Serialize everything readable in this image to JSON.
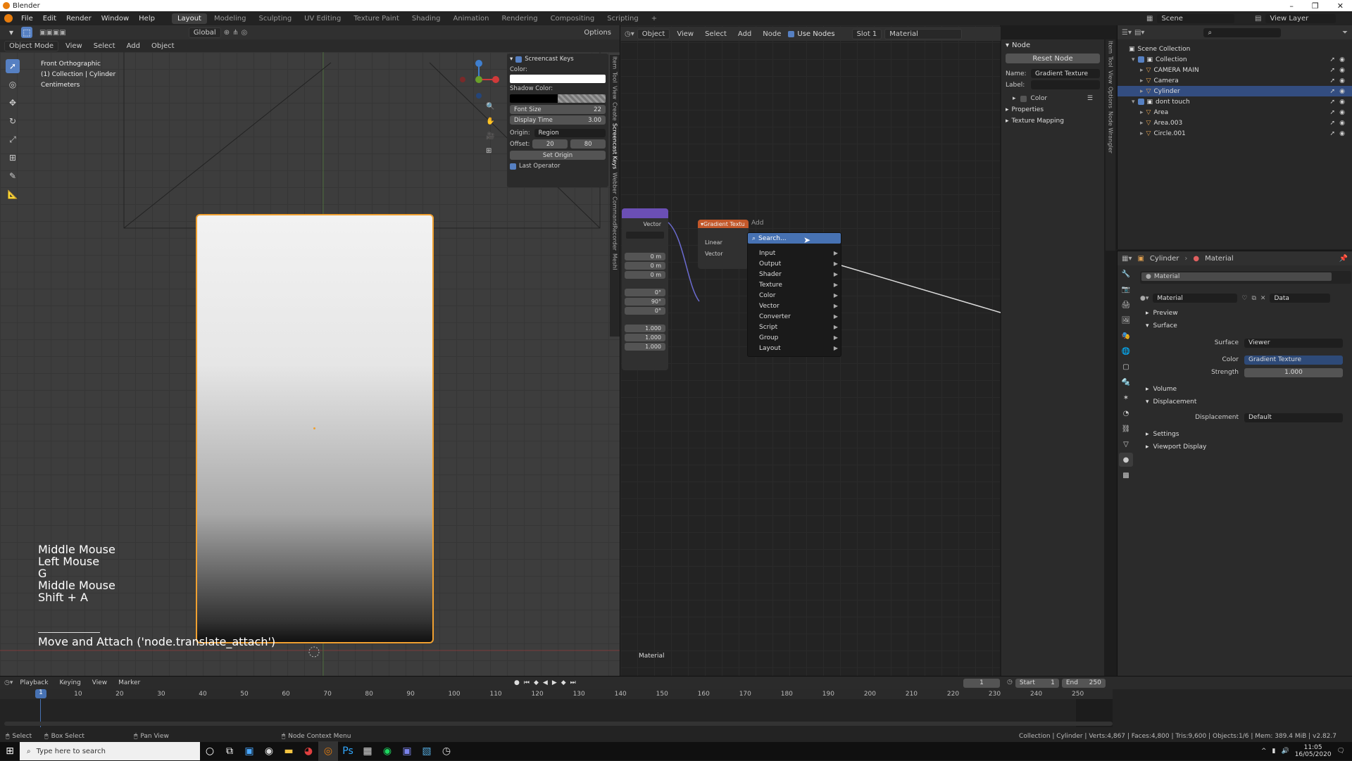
{
  "app": {
    "title": "Blender"
  },
  "menubar": {
    "items": [
      "File",
      "Edit",
      "Render",
      "Window",
      "Help"
    ],
    "workspaces": [
      "Layout",
      "Modeling",
      "Sculpting",
      "UV Editing",
      "Texture Paint",
      "Shading",
      "Animation",
      "Rendering",
      "Compositing",
      "Scripting"
    ],
    "active_workspace": "Layout",
    "scene_label": "Scene",
    "view_layer_label": "View Layer"
  },
  "viewport": {
    "mode": "Object Mode",
    "header_items": [
      "View",
      "Select",
      "Add",
      "Object"
    ],
    "orientation": "Global",
    "options": "Options",
    "info": {
      "line1": "Front Orthographic",
      "line2": "(1) Collection | Cylinder",
      "line3": "Centimeters"
    },
    "keys": [
      "Middle Mouse",
      "Left Mouse",
      "G",
      "Middle Mouse",
      "Shift + A"
    ],
    "operator_text": "Move and Attach ('node.translate_attach')",
    "side_tabs": [
      "Item",
      "Tool",
      "View",
      "Create",
      "Screencast Keys",
      "Webber",
      "CommandRecorder",
      "MeshI"
    ]
  },
  "screencast": {
    "title": "Screencast Keys",
    "color_label": "Color:",
    "shadow_label": "Shadow Color:",
    "font_size_label": "Font Size",
    "font_size": "22",
    "display_time_label": "Display Time",
    "display_time": "3.00",
    "origin_label": "Origin:",
    "origin_value": "Region",
    "offset_label": "Offset:",
    "offset_x": "20",
    "offset_y": "80",
    "set_origin": "Set Origin",
    "last_operator": "Last Operator"
  },
  "node_editor": {
    "header": {
      "object": "Object",
      "view": "View",
      "select": "Select",
      "add": "Add",
      "node": "Node",
      "use_nodes": "Use Nodes",
      "slot": "Slot 1",
      "material": "Material"
    },
    "mapping_node": {
      "vector": "Vector",
      "values": [
        "0 m",
        "0 m",
        "0 m",
        "0°",
        "90°",
        "0°",
        "1.000",
        "1.000",
        "1.000"
      ]
    },
    "gradient_node": {
      "title": "Gradient Textu",
      "type": "Linear",
      "vector": "Vector"
    },
    "add_menu": {
      "title": "Add",
      "search": "Search...",
      "items": [
        "Input",
        "Output",
        "Shader",
        "Texture",
        "Color",
        "Vector",
        "Converter",
        "Script",
        "Group",
        "Layout"
      ]
    },
    "footer_label": "Material",
    "side_tabs": [
      "Item",
      "Tool",
      "View",
      "Options",
      "Node Wrangler"
    ]
  },
  "node_panel": {
    "title": "Node",
    "reset": "Reset Node",
    "name_label": "Name:",
    "name_value": "Gradient Texture",
    "label_label": "Label:",
    "color": "Color",
    "properties": "Properties",
    "texture_mapping": "Texture Mapping"
  },
  "outliner": {
    "scene_collection": "Scene Collection",
    "rows": [
      {
        "label": "Collection",
        "indent": 1
      },
      {
        "label": "CAMERA MAIN",
        "indent": 2
      },
      {
        "label": "Camera",
        "indent": 2
      },
      {
        "label": "Cylinder",
        "indent": 2,
        "selected": true
      },
      {
        "label": "dont touch",
        "indent": 1
      },
      {
        "label": "Area",
        "indent": 2
      },
      {
        "label": "Area.003",
        "indent": 2
      },
      {
        "label": "Circle.001",
        "indent": 2
      }
    ]
  },
  "properties": {
    "breadcrumb_object": "Cylinder",
    "breadcrumb_material": "Material",
    "slot": "Material",
    "material_name": "Material",
    "data_label": "Data",
    "sections": {
      "preview": "Preview",
      "surface": "Surface",
      "volume": "Volume",
      "displacement": "Displacement",
      "settings": "Settings",
      "viewport_display": "Viewport Display"
    },
    "surface_label": "Surface",
    "surface_value": "Viewer",
    "color_label": "Color",
    "color_value": "Gradient Texture",
    "strength_label": "Strength",
    "strength_value": "1.000",
    "displacement_label": "Displacement",
    "displacement_value": "Default"
  },
  "timeline": {
    "items": [
      "Playback",
      "Keying",
      "View",
      "Marker"
    ],
    "current_frame": "1",
    "start_label": "Start",
    "start": "1",
    "end_label": "End",
    "end": "250",
    "ticks": [
      "10",
      "20",
      "30",
      "40",
      "50",
      "60",
      "70",
      "80",
      "90",
      "100",
      "110",
      "120",
      "130",
      "140",
      "150",
      "160",
      "170",
      "180",
      "190",
      "200",
      "210",
      "220",
      "230",
      "240",
      "250"
    ],
    "cursor_frame": "1"
  },
  "statusbar": {
    "select": "Select",
    "box_select": "Box Select",
    "pan_view": "Pan View",
    "node_context": "Node Context Menu",
    "stats": "Collection | Cylinder | Verts:4,867 | Faces:4,800 | Tris:9,600 | Objects:1/6 | Mem: 389.4 MiB | v2.82.7"
  },
  "taskbar": {
    "search_placeholder": "Type here to search",
    "time": "11:05",
    "date": "16/05/2020"
  },
  "colors": {
    "accent": "#5680c2",
    "selection": "#334d80",
    "object_outline": "#f0a030",
    "node_header_orange": "#c4582a",
    "node_header_purple": "#6b4fb5"
  }
}
